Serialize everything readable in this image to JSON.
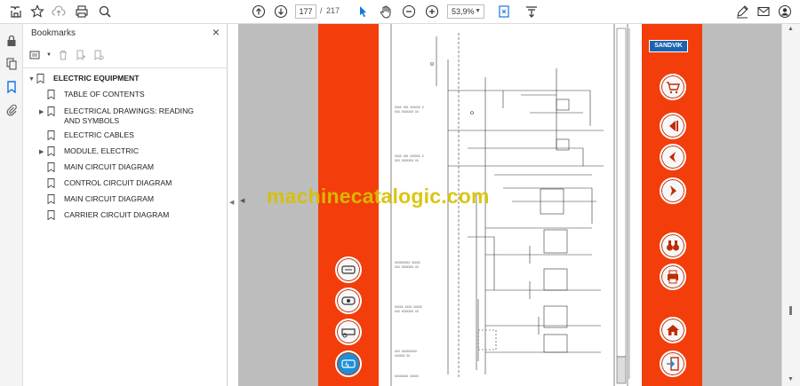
{
  "toolbar": {
    "page_current": "177",
    "page_separator": "/",
    "page_total": "217",
    "zoom": "53,9%"
  },
  "bookmarks": {
    "title": "Bookmarks",
    "close": "×",
    "items": [
      {
        "label": "ELECTRIC EQUIPMENT",
        "expanded": true
      },
      {
        "label": "TABLE OF CONTENTS"
      },
      {
        "label": "ELECTRICAL DRAWINGS: READING AND SYMBOLS"
      },
      {
        "label": "ELECTRIC CABLES"
      },
      {
        "label": "MODULE, ELECTRIC"
      },
      {
        "label": "MAIN CIRCUIT DIAGRAM"
      },
      {
        "label": "CONTROL CIRCUIT DIAGRAM"
      },
      {
        "label": "MAIN CIRCUIT DIAGRAM"
      },
      {
        "label": "CARRIER CIRCUIT DIAGRAM"
      }
    ]
  },
  "document": {
    "brand": "SANDVIK",
    "watermark": "machinecatalogic.com",
    "band_color": "#f33d0b",
    "active_button_color": "#1e8fd6"
  }
}
